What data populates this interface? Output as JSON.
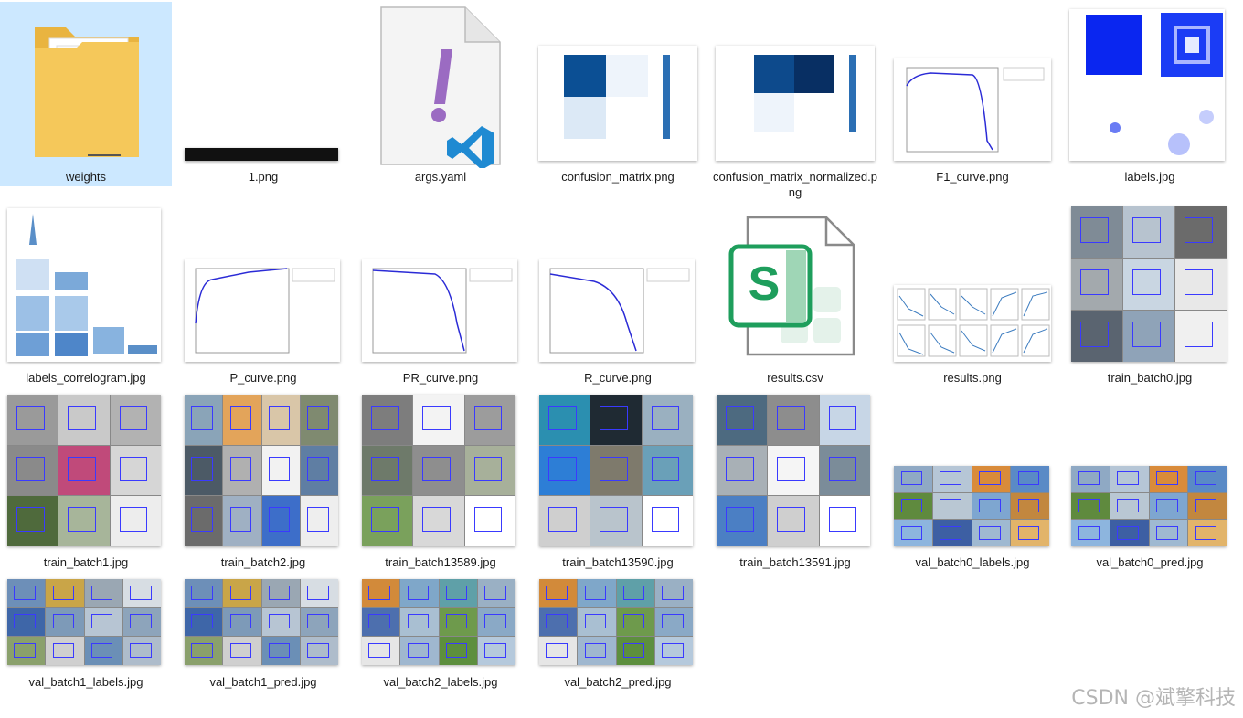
{
  "files": [
    {
      "name": "weights"
    },
    {
      "name": "1.png"
    },
    {
      "name": "args.yaml"
    },
    {
      "name": "confusion_matrix.png"
    },
    {
      "name": "confusion_matrix_normalized.png"
    },
    {
      "name": "F1_curve.png"
    },
    {
      "name": "labels.jpg"
    },
    {
      "name": "labels_correlogram.jpg"
    },
    {
      "name": "P_curve.png"
    },
    {
      "name": "PR_curve.png"
    },
    {
      "name": "R_curve.png"
    },
    {
      "name": "results.csv"
    },
    {
      "name": "results.png"
    },
    {
      "name": "train_batch0.jpg"
    },
    {
      "name": "train_batch1.jpg"
    },
    {
      "name": "train_batch2.jpg"
    },
    {
      "name": "train_batch13589.jpg"
    },
    {
      "name": "train_batch13590.jpg"
    },
    {
      "name": "train_batch13591.jpg"
    },
    {
      "name": "val_batch0_labels.jpg"
    },
    {
      "name": "val_batch0_pred.jpg"
    },
    {
      "name": "val_batch1_labels.jpg"
    },
    {
      "name": "val_batch1_pred.jpg"
    },
    {
      "name": "val_batch2_labels.jpg"
    },
    {
      "name": "val_batch2_pred.jpg"
    }
  ],
  "watermark": "CSDN @斌擎科技",
  "colors": {
    "selection": "#cce8ff",
    "folder": "#f5c85a",
    "yaml_mark": "#9b6bc2",
    "vscode_blue": "#1f8ad2",
    "sheets_green": "#1e9e5c",
    "plot_curve": "#2b2bd6",
    "matrix_dark": "#0b3d7a"
  }
}
